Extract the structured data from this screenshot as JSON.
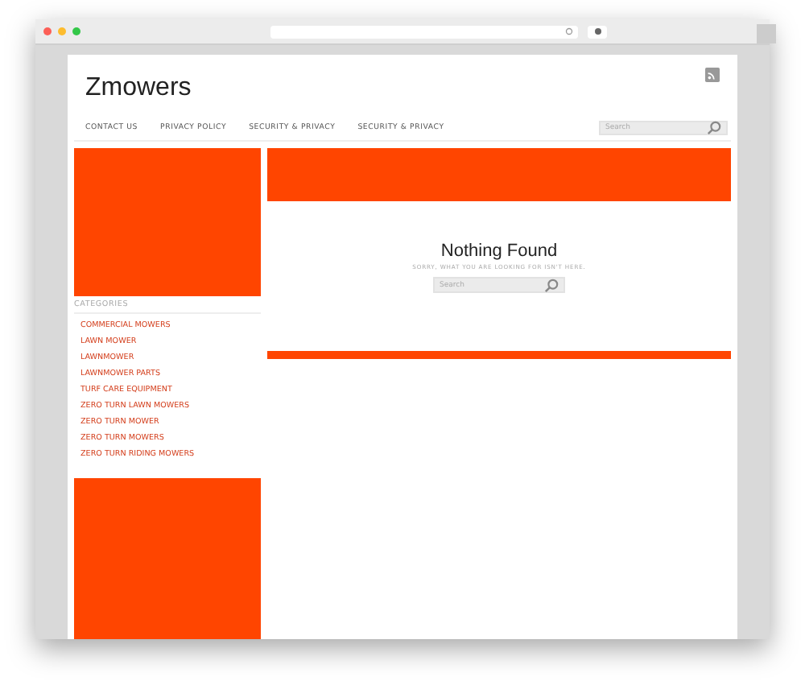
{
  "site": {
    "title": "Zmowers"
  },
  "nav": {
    "items": [
      "CONTACT US",
      "PRIVACY POLICY",
      "SECURITY & PRIVACY",
      "SECURITY & PRIVACY"
    ],
    "search": {
      "placeholder": "Search"
    }
  },
  "sidebar": {
    "heading": "CATEGORIES",
    "items": [
      "COMMERCIAL MOWERS",
      "LAWN MOWER",
      "LAWNMOWER",
      "LAWNMOWER PARTS",
      "TURF CARE EQUIPMENT",
      "ZERO TURN LAWN MOWERS",
      "ZERO TURN MOWER",
      "ZERO TURN MOWERS",
      "ZERO TURN RIDING MOWERS"
    ]
  },
  "main": {
    "title": "Nothing Found",
    "message": "SORRY, WHAT YOU ARE LOOKING FOR ISN'T HERE.",
    "search": {
      "placeholder": "Search"
    }
  }
}
